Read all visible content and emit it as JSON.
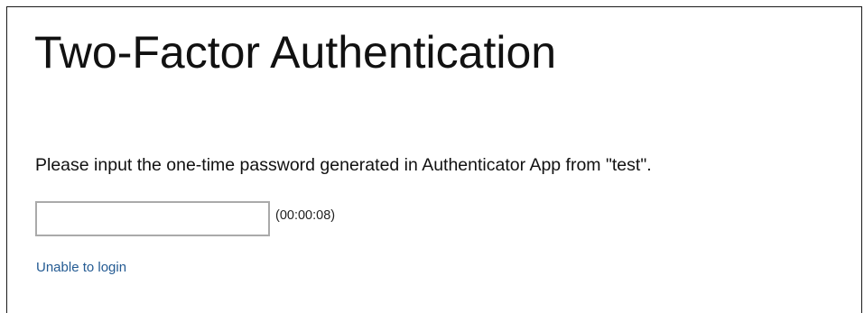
{
  "page": {
    "title": "Two-Factor Authentication",
    "instruction": "Please input the one-time password generated in Authenticator App from \"test\".",
    "otp_input": {
      "value": "",
      "placeholder": ""
    },
    "timer": "(00:00:08)",
    "help_link": "Unable to login"
  },
  "colors": {
    "link": "#245b93",
    "text": "#111111",
    "input_border": "#aaaaaa",
    "frame_border": "#1a1a1a"
  }
}
